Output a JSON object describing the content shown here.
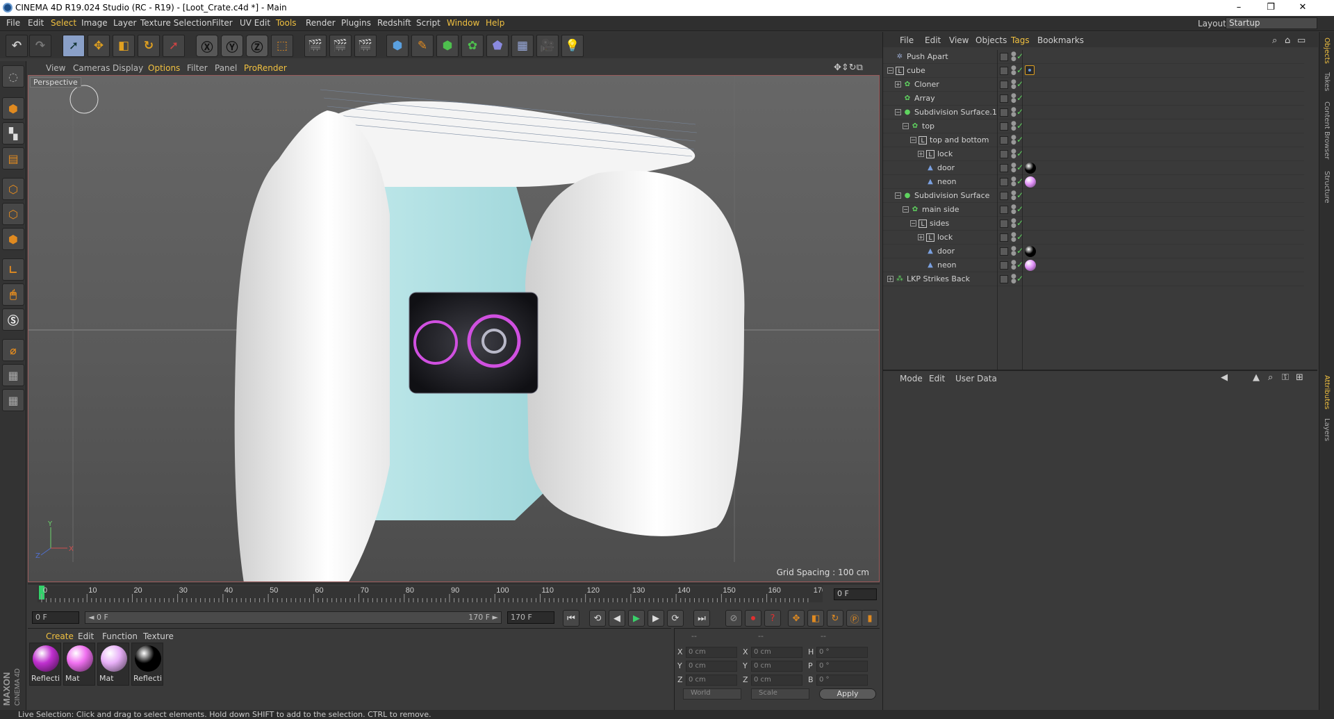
{
  "window": {
    "title": "CINEMA 4D R19.024 Studio (RC - R19) - [Loot_Crate.c4d *] - Main",
    "minimize": "–",
    "maximize": "❐",
    "close": "✕"
  },
  "menubar": {
    "items": [
      "File",
      "Edit",
      "Select",
      "Image",
      "Layer",
      "Texture Selection",
      "Filter",
      "UV Edit",
      "Tools",
      "Render",
      "Plugins",
      "Redshift",
      "Script",
      "Window",
      "Help"
    ],
    "layout_label": "Layout:",
    "layout_value": "Startup"
  },
  "viewport": {
    "menu": [
      "View",
      "Cameras",
      "Display",
      "Options",
      "Filter",
      "Panel",
      "ProRender"
    ],
    "camera_label": "Perspective",
    "grid_spacing": "Grid Spacing : 100 cm",
    "axis_y": "Y",
    "axis_x": "X",
    "axis_z": "Z"
  },
  "timeline": {
    "ticks": [
      "0",
      "10",
      "20",
      "30",
      "40",
      "50",
      "60",
      "70",
      "80",
      "90",
      "100",
      "110",
      "120",
      "130",
      "140",
      "150",
      "160",
      "170"
    ],
    "current_frame": "0 F"
  },
  "transport": {
    "start_field": "0 F",
    "range_start": "◄ 0 F",
    "range_end": "170 F ►",
    "end_field": "170 F"
  },
  "material_manager": {
    "menu": [
      "Create",
      "Edit",
      "Function",
      "Texture"
    ],
    "materials": [
      {
        "name": "Reflecti",
        "color": "#c030d0"
      },
      {
        "name": "Mat",
        "color": "#f070f0"
      },
      {
        "name": "Mat",
        "color": "#e8b0f8"
      },
      {
        "name": "Reflecti",
        "color": "#000000"
      }
    ]
  },
  "coordinates": {
    "header": [
      "--",
      "--",
      "--"
    ],
    "rows": [
      {
        "a": "X",
        "av": "0 cm",
        "b": "X",
        "bv": "0 cm",
        "c": "H",
        "cv": "0 °"
      },
      {
        "a": "Y",
        "av": "0 cm",
        "b": "Y",
        "bv": "0 cm",
        "c": "P",
        "cv": "0 °"
      },
      {
        "a": "Z",
        "av": "0 cm",
        "b": "Z",
        "bv": "0 cm",
        "c": "B",
        "cv": "0 °"
      }
    ],
    "world": "World",
    "scale": "Scale",
    "apply": "Apply"
  },
  "object_manager": {
    "menu": [
      "File",
      "Edit",
      "View",
      "Objects",
      "Tags",
      "Bookmarks"
    ],
    "objects": [
      {
        "name": "Push Apart",
        "depth": 0,
        "icon": "✲",
        "exp": "",
        "tag": ""
      },
      {
        "name": "cube",
        "depth": 0,
        "icon": "L",
        "exp": "−",
        "tag": "#3a6ad0"
      },
      {
        "name": "Cloner",
        "depth": 1,
        "icon": "✿",
        "exp": "+",
        "tag": ""
      },
      {
        "name": "Array",
        "depth": 1,
        "icon": "✿",
        "exp": "",
        "tag": ""
      },
      {
        "name": "Subdivision Surface.1",
        "depth": 1,
        "icon": "●",
        "exp": "−",
        "tag": ""
      },
      {
        "name": "top",
        "depth": 2,
        "icon": "✿",
        "exp": "−",
        "tag": ""
      },
      {
        "name": "top and bottom",
        "depth": 3,
        "icon": "L",
        "exp": "−",
        "tag": ""
      },
      {
        "name": "lock",
        "depth": 4,
        "icon": "L",
        "exp": "+",
        "tag": ""
      },
      {
        "name": "door",
        "depth": 4,
        "icon": "▲",
        "exp": "",
        "tag": "#000000"
      },
      {
        "name": "neon",
        "depth": 4,
        "icon": "▲",
        "exp": "",
        "tag": "#e090f8"
      },
      {
        "name": "Subdivision Surface",
        "depth": 1,
        "icon": "●",
        "exp": "−",
        "tag": ""
      },
      {
        "name": "main side",
        "depth": 2,
        "icon": "✿",
        "exp": "−",
        "tag": ""
      },
      {
        "name": "sides",
        "depth": 3,
        "icon": "L",
        "exp": "−",
        "tag": ""
      },
      {
        "name": "lock",
        "depth": 4,
        "icon": "L",
        "exp": "+",
        "tag": ""
      },
      {
        "name": "door",
        "depth": 4,
        "icon": "▲",
        "exp": "",
        "tag": "#000000"
      },
      {
        "name": "neon",
        "depth": 4,
        "icon": "▲",
        "exp": "",
        "tag": "#e090f8"
      },
      {
        "name": "LKP Strikes Back",
        "depth": 0,
        "icon": "⁂",
        "exp": "+",
        "tag": ""
      }
    ]
  },
  "attribute_manager": {
    "menu": [
      "Mode",
      "Edit",
      "User Data"
    ]
  },
  "right_tabs": [
    "Objects",
    "Takes",
    "Content Browser",
    "Structure",
    "Attributes",
    "Layers"
  ],
  "maxon": {
    "brand": "MAXON",
    "product": "CINEMA 4D"
  },
  "status": {
    "text": "Live Selection: Click and drag to select elements. Hold down SHIFT to add to the selection. CTRL to remove."
  }
}
